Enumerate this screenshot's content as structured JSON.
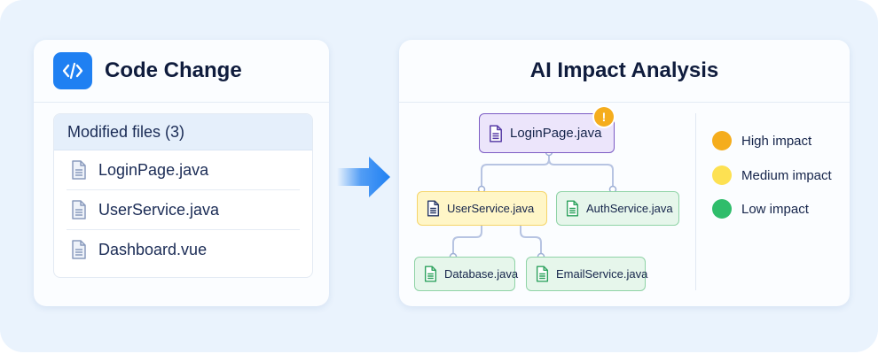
{
  "left_panel": {
    "title": "Code Change",
    "files_header": "Modified files (3)",
    "files": [
      "LoginPage.java",
      "UserService.java",
      "Dashboard.vue"
    ]
  },
  "right_panel": {
    "title": "AI Impact Analysis",
    "alert_badge": "!",
    "nodes": {
      "root": "LoginPage.java",
      "user_service": "UserService.java",
      "auth_service": "AuthService.java",
      "database": "Database.java",
      "email_service": "EmailService.java"
    },
    "legend": [
      {
        "label": "High impact",
        "color": "#f5ad1d"
      },
      {
        "label": "Medium impact",
        "color": "#fde152"
      },
      {
        "label": "Low impact",
        "color": "#2fbd6b"
      }
    ]
  },
  "colors": {
    "accent": "#1f80f2",
    "high": "#7c5cc4",
    "medium": "#f5d56a",
    "low": "#8fd3a6",
    "edge": "#b7c4e2"
  }
}
